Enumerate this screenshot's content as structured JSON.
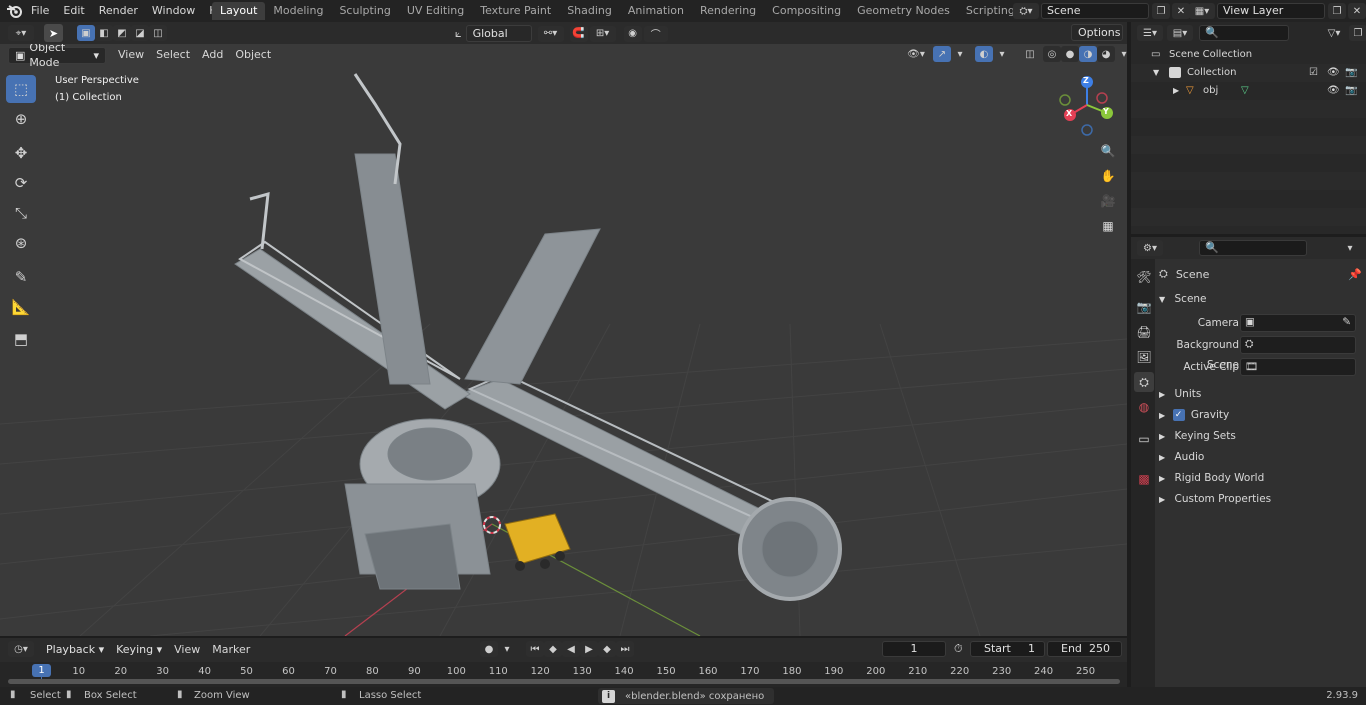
{
  "topbar": {
    "menus": [
      "File",
      "Edit",
      "Render",
      "Window",
      "Help"
    ],
    "workspaces": [
      "Layout",
      "Modeling",
      "Sculpting",
      "UV Editing",
      "Texture Paint",
      "Shading",
      "Animation",
      "Rendering",
      "Compositing",
      "Geometry Nodes",
      "Scripting"
    ],
    "active_workspace": "Layout",
    "add_tab": "+",
    "scene_value": "Scene",
    "view_layer_value": "View Layer"
  },
  "viewport": {
    "mode": "Object Mode",
    "menus": [
      "View",
      "Select",
      "Add",
      "Object"
    ],
    "orientation": "Global",
    "options_label": "Options",
    "overlay_title": "User Perspective",
    "overlay_collection": "(1) Collection",
    "gizmo": {
      "z": "Z",
      "x": "X",
      "y": "Y"
    },
    "colors": {
      "x_axis": "#e44055",
      "y_axis": "#8bc73b",
      "z_axis": "#3d7fe6",
      "active_tool": "#4772b3"
    }
  },
  "outliner": {
    "search_placeholder": "",
    "scene_collection": "Scene Collection",
    "collection": "Collection",
    "object": "obj"
  },
  "properties": {
    "context_title": "Scene",
    "panel_scene": "Scene",
    "camera_label": "Camera",
    "background_scene_label": "Background Scene",
    "active_clip_label": "Active Clip",
    "subpanels": [
      "Units",
      "Gravity",
      "Keying Sets",
      "Audio",
      "Rigid Body World",
      "Custom Properties"
    ],
    "gravity_checked": true
  },
  "timeline": {
    "menus": [
      "Playback",
      "Keying",
      "View",
      "Marker"
    ],
    "current_frame": "1",
    "start_label": "Start",
    "start_value": "1",
    "end_label": "End",
    "end_value": "250",
    "ruler_current": "1",
    "ticks": [
      "10",
      "20",
      "30",
      "40",
      "50",
      "60",
      "70",
      "80",
      "90",
      "100",
      "110",
      "120",
      "130",
      "140",
      "150",
      "160",
      "170",
      "180",
      "190",
      "200",
      "210",
      "220",
      "230",
      "240",
      "250"
    ]
  },
  "statusbar": {
    "select": "Select",
    "box_select": "Box Select",
    "zoom_view": "Zoom View",
    "lasso_select": "Lasso Select",
    "message": "«blender.blend» сохранено",
    "version": "2.93.9"
  }
}
